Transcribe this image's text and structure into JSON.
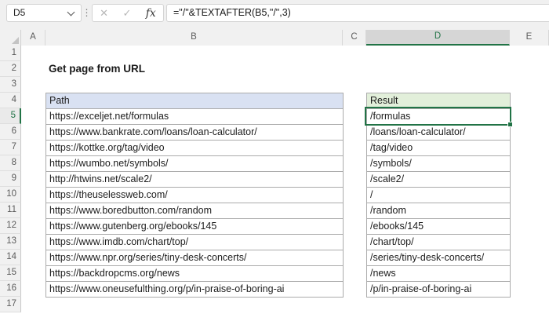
{
  "formula_bar": {
    "cell_reference": "D5",
    "formula": "=\"/\"&TEXTAFTER(B5,\"/\",3)",
    "fx_label": "fx",
    "cancel_icon": "✕",
    "enter_icon": "✓",
    "separator_icon": "⋮"
  },
  "sheet": {
    "title": "Get page from URL",
    "column_headers": [
      "A",
      "B",
      "C",
      "D",
      "E"
    ],
    "selected_column": "D",
    "selected_row": 5,
    "row_numbers": [
      1,
      2,
      3,
      4,
      5,
      6,
      7,
      8,
      9,
      10,
      11,
      12,
      13,
      14,
      15,
      16,
      17
    ],
    "table": {
      "path_header": "Path",
      "result_header": "Result",
      "rows": [
        {
          "path": "https://exceljet.net/formulas",
          "result": "/formulas"
        },
        {
          "path": "https://www.bankrate.com/loans/loan-calculator/",
          "result": "/loans/loan-calculator/"
        },
        {
          "path": "https://kottke.org/tag/video",
          "result": "/tag/video"
        },
        {
          "path": "https://wumbo.net/symbols/",
          "result": "/symbols/"
        },
        {
          "path": "http://htwins.net/scale2/",
          "result": "/scale2/"
        },
        {
          "path": "https://theuselessweb.com/",
          "result": "/"
        },
        {
          "path": "https://www.boredbutton.com/random",
          "result": "/random"
        },
        {
          "path": "https://www.gutenberg.org/ebooks/145",
          "result": "/ebooks/145"
        },
        {
          "path": "https://www.imdb.com/chart/top/",
          "result": "/chart/top/"
        },
        {
          "path": "https://www.npr.org/series/tiny-desk-concerts/",
          "result": "/series/tiny-desk-concerts/"
        },
        {
          "path": "https://backdropcms.org/news",
          "result": "/news"
        },
        {
          "path": "https://www.oneusefulthing.org/p/in-praise-of-boring-ai",
          "result": "/p/in-praise-of-boring-ai"
        }
      ]
    }
  },
  "colors": {
    "selection_green": "#217346",
    "path_header_bg": "#D9E1F2",
    "result_header_bg": "#E2EFDA"
  }
}
